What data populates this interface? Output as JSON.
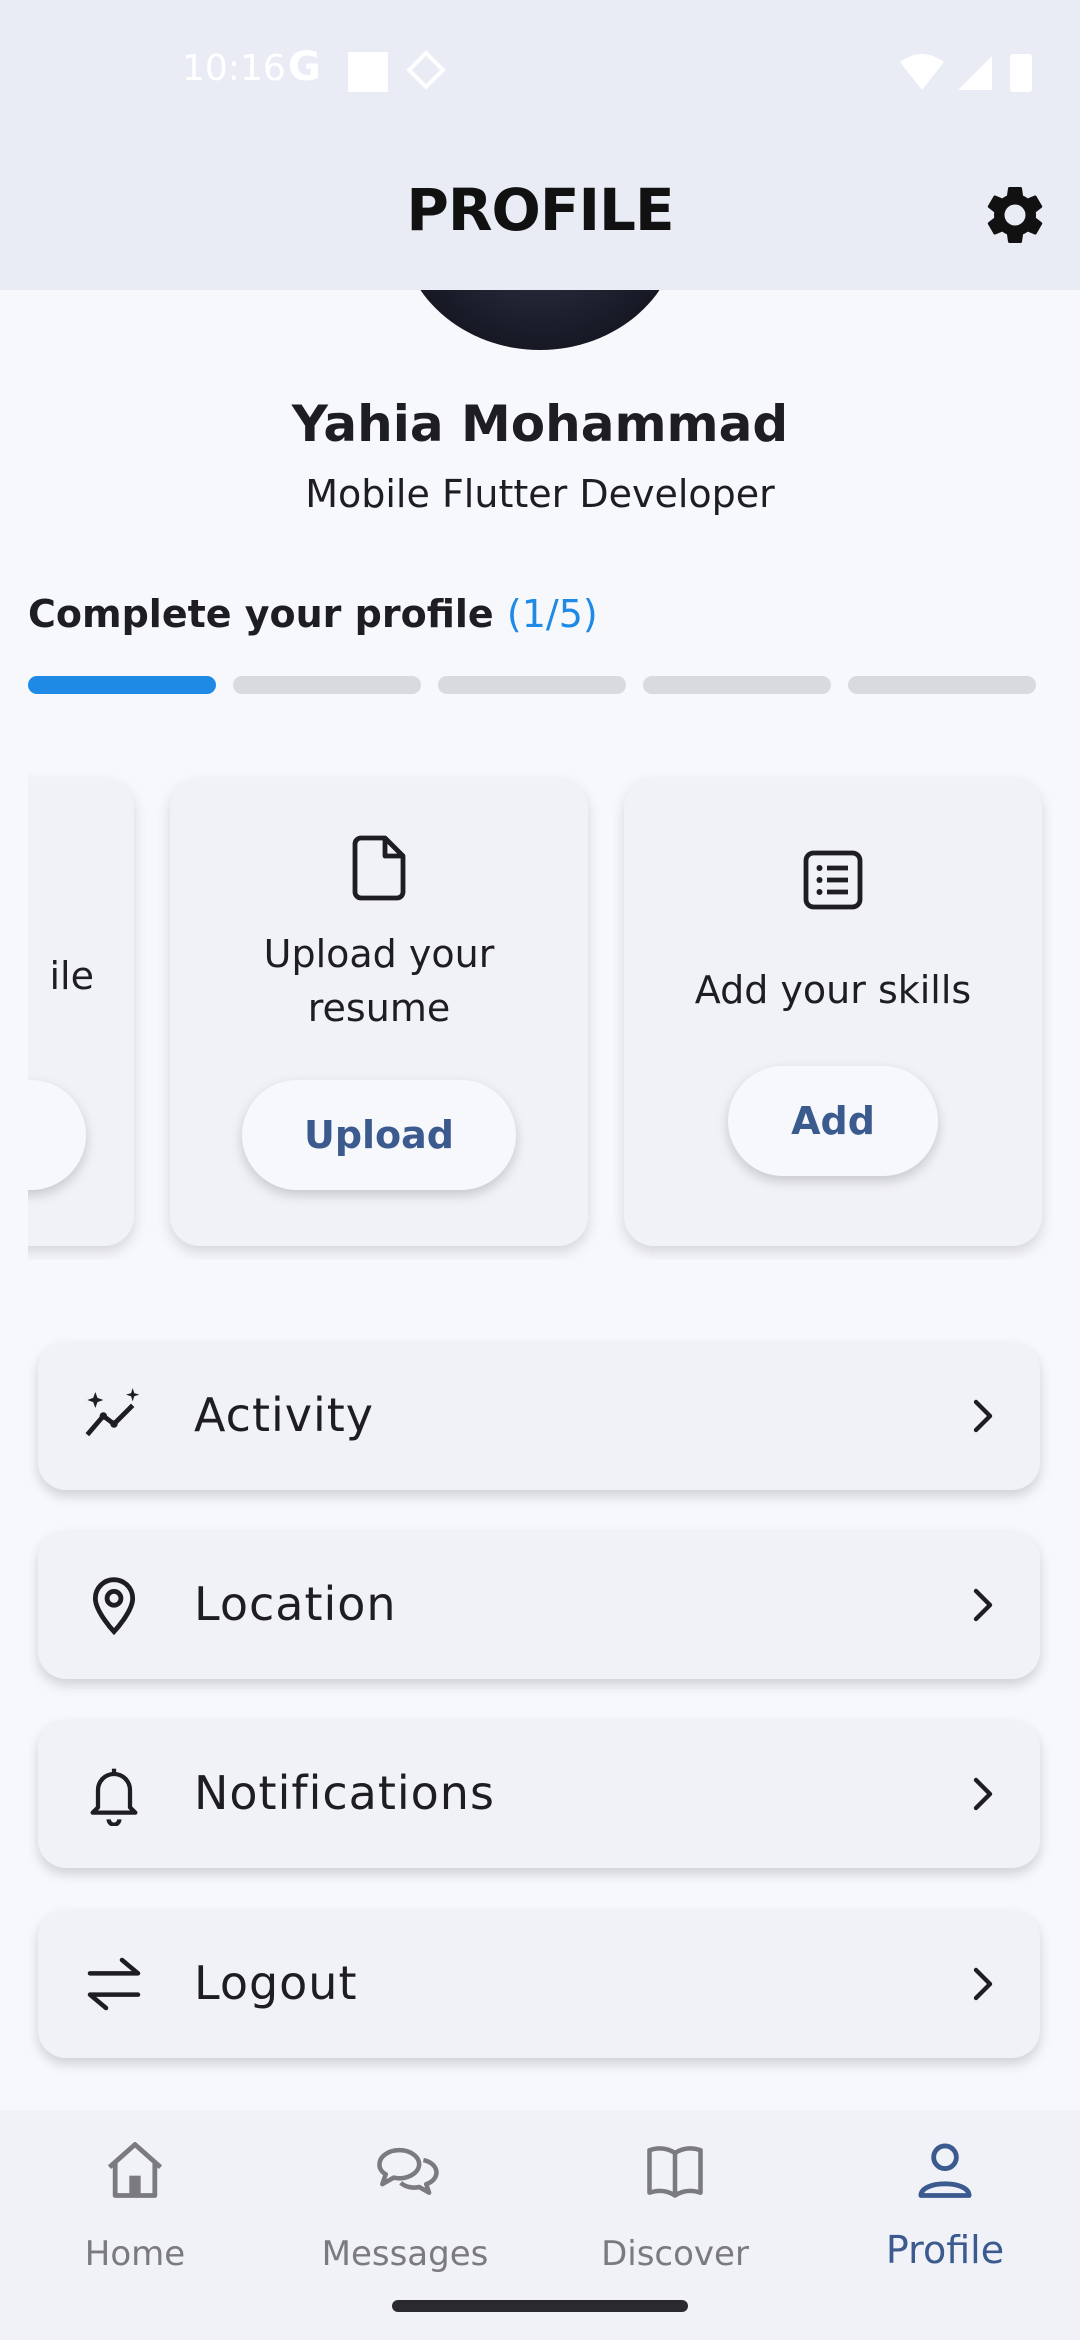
{
  "status_bar": {
    "time": "10:16",
    "g_label": "G"
  },
  "header": {
    "title": "PROFILE"
  },
  "user": {
    "name": "Yahia Mohammad",
    "role": "Mobile Flutter Developer"
  },
  "completion": {
    "label": "Complete your profile",
    "count": "(1/5)",
    "completed": 1,
    "total": 5
  },
  "cards": [
    {
      "text": "ile",
      "button": ""
    },
    {
      "text_line1": "Upload your",
      "text_line2": "resume",
      "button": "Upload",
      "icon": "file-icon"
    },
    {
      "text": "Add your skills",
      "button": "Add",
      "icon": "list-icon"
    }
  ],
  "menu": [
    {
      "label": "Activity",
      "icon": "activity-sparkle-icon"
    },
    {
      "label": "Location",
      "icon": "location-pin-icon"
    },
    {
      "label": "Notifications",
      "icon": "bell-icon"
    },
    {
      "label": "Logout",
      "icon": "swap-arrows-icon"
    }
  ],
  "nav": [
    {
      "label": "Home",
      "icon": "home-icon"
    },
    {
      "label": "Messages",
      "icon": "chat-bubbles-icon"
    },
    {
      "label": "Discover",
      "icon": "book-icon"
    },
    {
      "label": "Profile",
      "icon": "person-icon",
      "active": true
    }
  ],
  "colors": {
    "accent": "#1e8ae6",
    "button_text": "#3b5a8e",
    "header_bg": "#e9ecf5"
  }
}
